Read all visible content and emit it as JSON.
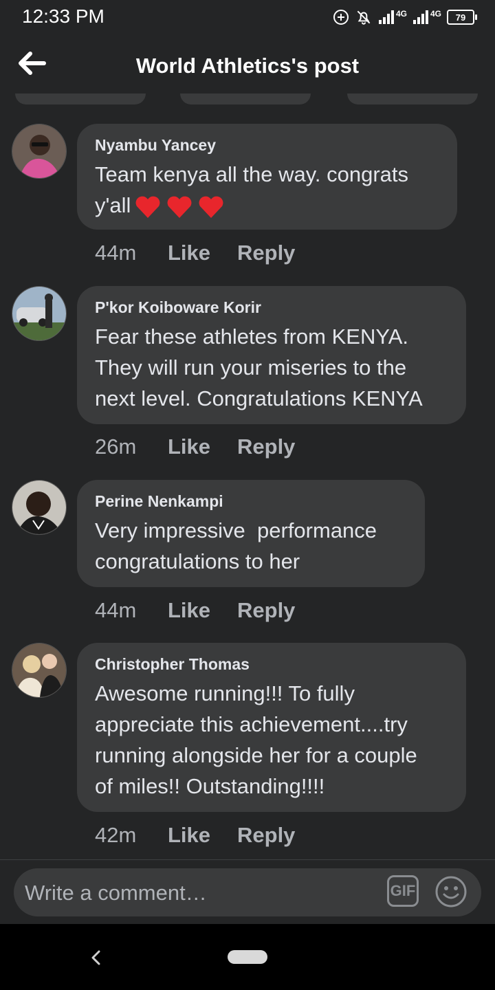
{
  "status_bar": {
    "time": "12:33 PM",
    "network_1": "4G",
    "network_2": "4G",
    "battery": "79"
  },
  "header": {
    "title": "World Athletics's post"
  },
  "comments": [
    {
      "author": "Nyambu Yancey",
      "text": "Team kenya all the way. congrats\ny'all",
      "hearts": 3,
      "time": "44m",
      "like": "Like",
      "reply": "Reply"
    },
    {
      "author": "P'kor Koiboware Korir",
      "text": "Fear these athletes from KENYA.\nThey will run your miseries to the\nnext level. Congratulations KENYA",
      "time": "26m",
      "like": "Like",
      "reply": "Reply"
    },
    {
      "author": "Perine Nenkampi",
      "text": "Very impressive  performance\ncongratulations to her",
      "time": "44m",
      "like": "Like",
      "reply": "Reply"
    },
    {
      "author": "Christopher Thomas",
      "text": "Awesome running!!! To fully\nappreciate this achievement....try\nrunning alongside her for a couple\nof miles!! Outstanding!!!!",
      "time": "42m",
      "like": "Like",
      "reply": "Reply"
    }
  ],
  "composer": {
    "placeholder": "Write a comment…",
    "gif_label": "GIF"
  },
  "icons": {
    "back": "arrow-left-icon",
    "alarm": "add-alarm-icon",
    "bell": "bell-off-icon",
    "signal": "signal-icon",
    "gif": "gif-icon",
    "emoji": "smiley-icon",
    "nav_back": "chevron-left-icon"
  },
  "colors": {
    "background": "#242526",
    "bubble": "#3a3b3c",
    "text": "#e4e6eb",
    "meta": "#b0b3b8",
    "heart": "#e8262c"
  }
}
